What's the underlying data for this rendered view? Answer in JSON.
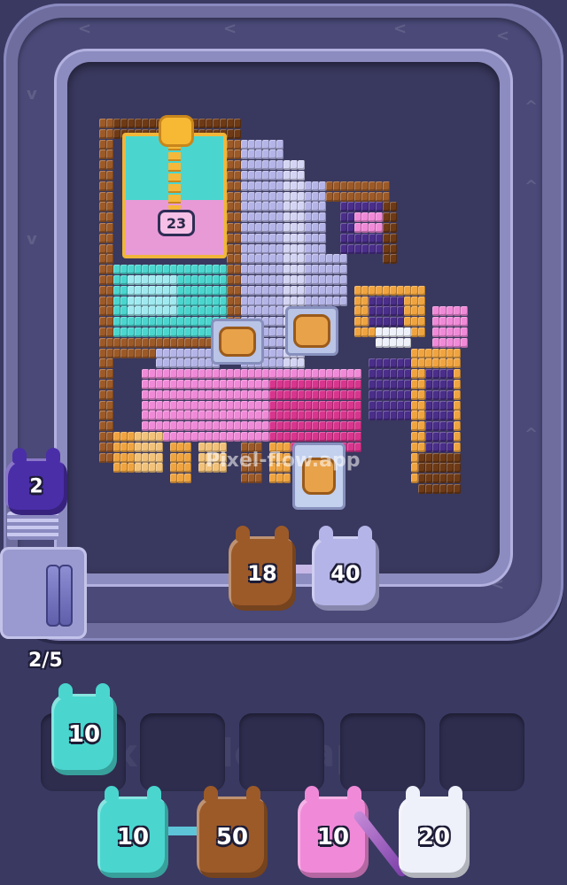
{
  "watermark": {
    "text": "Pixel-flow.app",
    "text_side": "Pixel-Flow.app",
    "text_slot": "Pixel-Flow.app"
  },
  "board": {
    "lock_counter": "23",
    "palette": {
      "brown": "#9c5a28",
      "dark_brown": "#6e3a16",
      "lavender": "#b4b4e8",
      "light_lavender": "#d4d4f4",
      "purple": "#4a2e8a",
      "pink": "#f08ad8",
      "magenta": "#d8358e",
      "orange": "#f0a440",
      "tan": "#f2c27a",
      "cyan": "#4ad6cf",
      "light_cyan": "#9eeaf0",
      "white": "#eef0fa",
      "lock_gold": "#f0b63a"
    }
  },
  "track": {
    "shooter_pigs": [
      {
        "value": "18",
        "color": "#9c5a28"
      },
      {
        "value": "40",
        "color": "#b4b4e8"
      }
    ],
    "waiting_pig": {
      "value": "2",
      "color": "#4a2ea8"
    },
    "queue_count": "2/5"
  },
  "slots": {
    "holding_pig": {
      "value": "10",
      "color": "#4ad6cf"
    }
  },
  "deck": [
    {
      "value": "10",
      "color": "#4ad6cf"
    },
    {
      "value": "50",
      "color": "#9c5a28"
    },
    {
      "value": "10",
      "color": "#f08ad8"
    },
    {
      "value": "20",
      "color": "#eef0fa"
    }
  ]
}
